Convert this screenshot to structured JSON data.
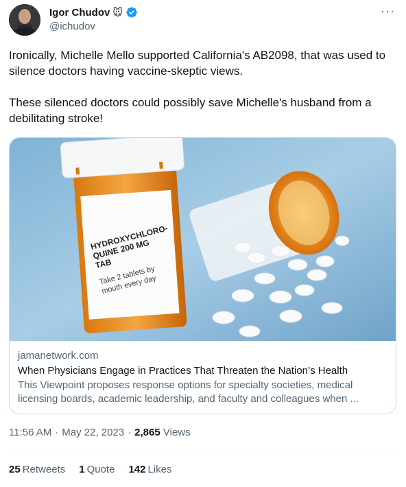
{
  "author": {
    "name": "Igor Chudov",
    "emoji": "🐭",
    "handle": "@ichudov"
  },
  "more_label": "···",
  "tweet_text": "Ironically, Michelle Mello supported California's AB2098, that was used to silence doctors having vaccine-skeptic views.\n\nThese silenced doctors could possibly save Michelle's husband from a debilitating stroke!",
  "card": {
    "label_line1": "HYDROXYCHLORO-",
    "label_line2": "QUINE 200 MG",
    "label_line3": "TAB",
    "label_line4": "Take 2 tablets by",
    "label_line5": "mouth every day",
    "domain": "jamanetwork.com",
    "title": "When Physicians Engage in Practices That Threaten the Nation’s Health",
    "description": "This Viewpoint proposes response options for specialty societies, medical licensing boards, academic leadership, and faculty and colleagues when ..."
  },
  "meta": {
    "time": "11:56 AM",
    "sep1": "·",
    "date": "May 22, 2023",
    "sep2": "·",
    "views_count": "2,865",
    "views_label": "Views"
  },
  "stats": {
    "retweets_count": "25",
    "retweets_label": "Retweets",
    "quotes_count": "1",
    "quotes_label": "Quote",
    "likes_count": "142",
    "likes_label": "Likes"
  },
  "colors": {
    "verified_blue": "#1d9bf0",
    "secondary_text": "#536471",
    "border": "#cfd9de"
  }
}
